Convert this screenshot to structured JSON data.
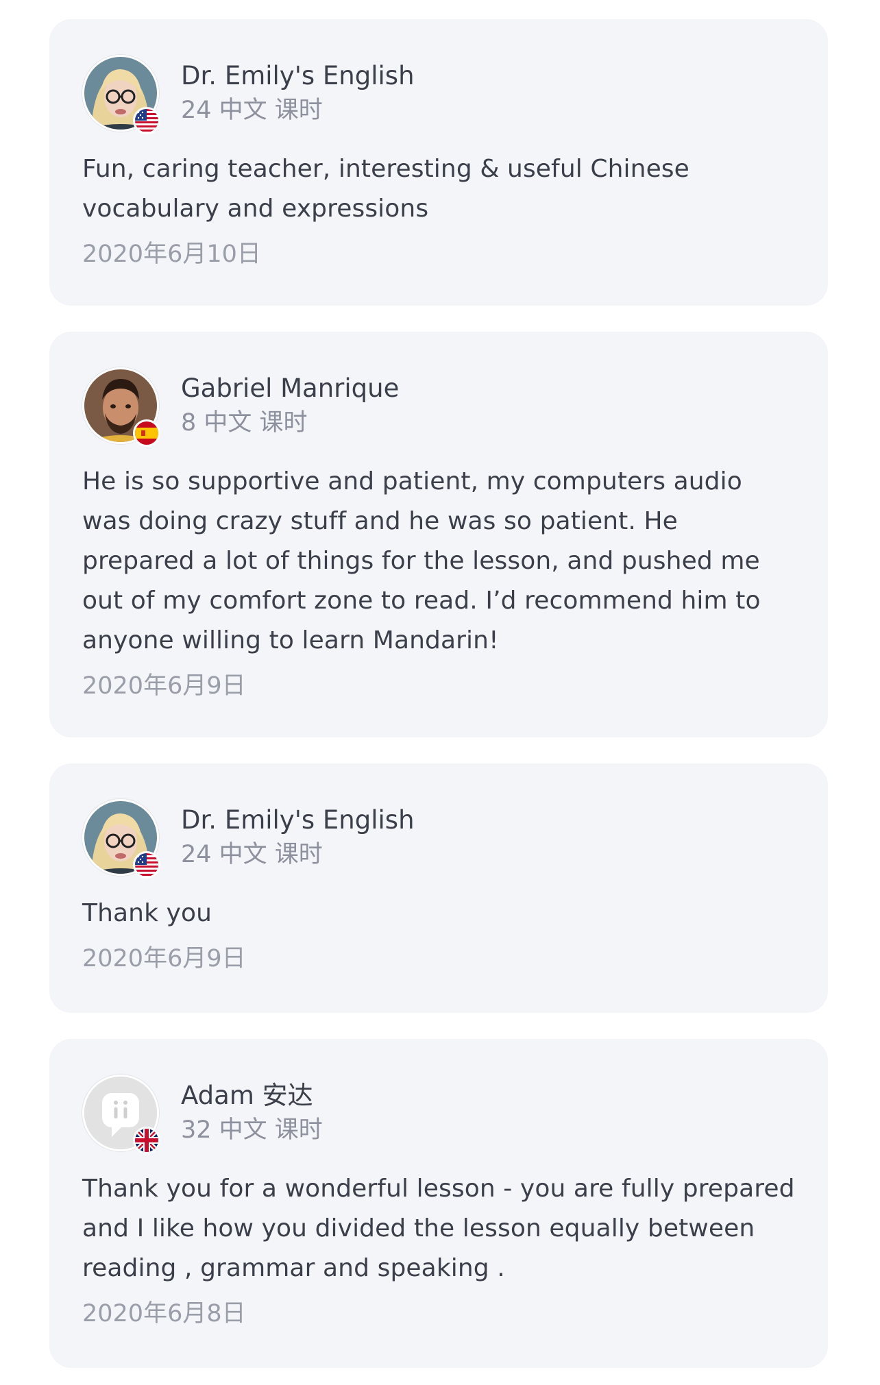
{
  "reviews": [
    {
      "name": "Dr. Emily's English",
      "lessons": "24 中文 课时",
      "comment": "Fun, caring teacher, interesting & useful Chinese vocabulary and expressions",
      "date": "2020年6月10日",
      "avatar": "photo-woman-glasses",
      "flag": "us-flag-icon"
    },
    {
      "name": "Gabriel Manrique",
      "lessons": "8 中文 课时",
      "comment": "He is so supportive and patient, my computers audio was doing crazy stuff and he was so patient. He prepared a lot of things for the lesson, and pushed me out of my comfort zone to read. I’d recommend him to anyone willing to learn Mandarin!",
      "date": "2020年6月9日",
      "avatar": "photo-man-beard",
      "flag": "spain-flag-icon"
    },
    {
      "name": "Dr. Emily's English",
      "lessons": "24 中文 课时",
      "comment": "Thank you",
      "date": "2020年6月9日",
      "avatar": "photo-woman-glasses",
      "flag": "us-flag-icon"
    },
    {
      "name": "Adam 安达",
      "lessons": "32 中文 课时",
      "comment": "Thank you for a wonderful lesson - you are fully prepared and I like how you divided the lesson equally between reading , grammar and speaking .",
      "date": "2020年6月8日",
      "avatar": "default-avatar-icon",
      "flag": "uk-flag-icon"
    }
  ]
}
